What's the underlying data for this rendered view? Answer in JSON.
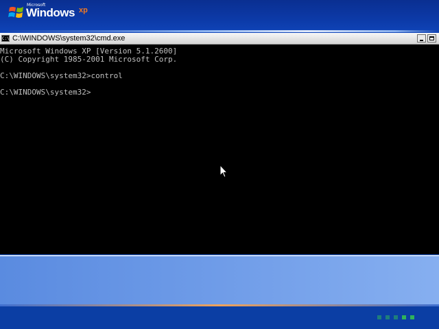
{
  "desktop": {
    "logo": {
      "microsoft": "Microsoft",
      "windows": "Windows",
      "xp": "xp"
    },
    "colors": {
      "background": "#0b3ea4",
      "accent": "#f47a20",
      "progress": "#2fb35a"
    },
    "progress_blocks": 5
  },
  "window": {
    "title": "C:\\WINDOWS\\system32\\cmd.exe",
    "icon_label": "C:\\",
    "controls": [
      "minimize",
      "maximize"
    ]
  },
  "console": {
    "lines": [
      "Microsoft Windows XP [Version 5.1.2600]",
      "(C) Copyright 1985-2001 Microsoft Corp.",
      "",
      "C:\\WINDOWS\\system32>control",
      "",
      "C:\\WINDOWS\\system32>"
    ]
  }
}
